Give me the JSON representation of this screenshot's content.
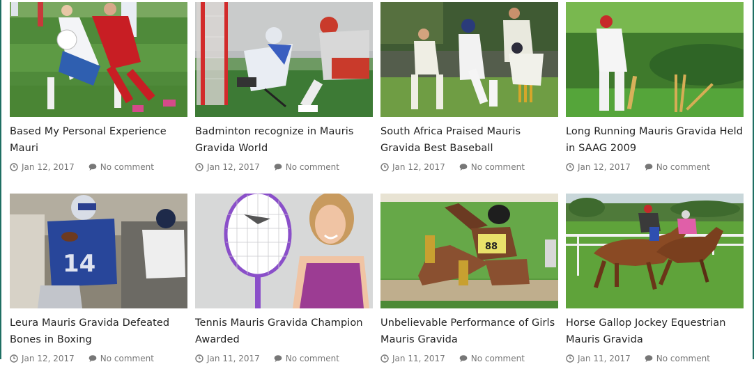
{
  "posts": [
    {
      "title": "Based My Personal Experience Mauri",
      "date": "Jan 12, 2017",
      "comments": "No comment",
      "image": "soccer"
    },
    {
      "title": "Badminton recognize in Mauris Gravida World",
      "date": "Jan 12, 2017",
      "comments": "No comment",
      "image": "lacrosse"
    },
    {
      "title": "South Africa Praised Mauris Gravida Best Baseball",
      "date": "Jan 12, 2017",
      "comments": "No comment",
      "image": "cricket-wicketkeeper"
    },
    {
      "title": "Long Running Mauris Gravida Held in SAAG 2009",
      "date": "Jan 12, 2017",
      "comments": "No comment",
      "image": "cricket-bowled"
    },
    {
      "title": "Leura Mauris Gravida Defeated Bones in Boxing",
      "date": "Jan 12, 2017",
      "comments": "No comment",
      "image": "american-football"
    },
    {
      "title": "Tennis Mauris Gravida Champion Awarded",
      "date": "Jan 11, 2017",
      "comments": "No comment",
      "image": "tennis-woman"
    },
    {
      "title": "Unbelievable Performance of Girls Mauris Gravida",
      "date": "Jan 11, 2017",
      "comments": "No comment",
      "image": "long-jump"
    },
    {
      "title": "Horse Gallop Jockey Equestrian Mauris Gravida",
      "date": "Jan 11, 2017",
      "comments": "No comment",
      "image": "horse-racing"
    }
  ],
  "icons": {
    "date": "clock-icon",
    "comments": "comment-icon"
  },
  "colors": {
    "title": "#222222",
    "meta": "#777777",
    "edge": "#1f6f63"
  }
}
